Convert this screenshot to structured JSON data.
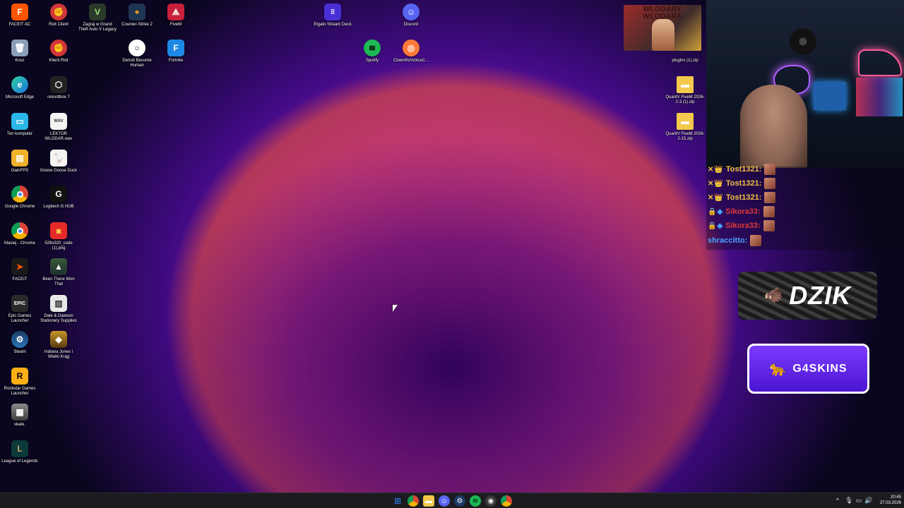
{
  "desktop_icons": {
    "faceit_ac": "FACEIT AC",
    "riot_client": "Riot Client",
    "gta": "Zagraj w Grand Theft Auto V Legacy",
    "cs2": "Counter-Strike 2",
    "fivem": "FiveM",
    "stream_deck": "Elgato Stream Deck",
    "discord": "Discord",
    "kosz": "Kosz",
    "klient_riot": "Klient Riot",
    "detroit": "Detroit Become Human",
    "fortnite": "Fortnite",
    "spotify": "Spotify",
    "clownfish": "ClownfishVoiceC...",
    "plugins": "plugins (1).zip",
    "edge": "Microsoft Edge",
    "rekordbox": "rekordbox 7",
    "quantv1": "QuantV FiveM 2026-2-3 (1).zip",
    "ten_komputer": "Ten komputer",
    "lektor": "LEKTOR WLODAR.wav",
    "quantv2": "QuantV FiveM 2026-2-15.zip",
    "gainfps": "GainFPS",
    "goose": "Goose Goose Duck",
    "chrome": "Google Chrome",
    "logitech": "Logitech G HUB",
    "maciej_chrome": "Maciej - Chrome",
    "png528": "528x320_code (1).png",
    "faceit": "FACEIT",
    "been_there": "Been There Won That",
    "epic": "Epic Games Launcher",
    "dale": "Dale & Dawson Stationery Supplies",
    "steam": "Steam",
    "indiana": "Indiana Jones i Wielki Krąg",
    "rockstar": "Rockstar Games Launcher",
    "skate": "skate.",
    "lol": "League of Legends"
  },
  "overlay": {
    "wlodara_title": "WLODARY WLODARA",
    "chat": [
      {
        "badges": "✕👑",
        "user": "Tost1321:",
        "color": "#f0c040"
      },
      {
        "badges": "✕👑",
        "user": "Tost1321:",
        "color": "#f0c040"
      },
      {
        "badges": "✕👑",
        "user": "Tost1321:",
        "color": "#f0c040"
      },
      {
        "badges": "🔒◆",
        "user": "Sikora33:",
        "color": "#e03a3a"
      },
      {
        "badges": "🔒◆",
        "user": "Sikora33:",
        "color": "#e03a3a"
      },
      {
        "badges": "",
        "user": "shraccitto:",
        "color": "#4aa3ff"
      }
    ],
    "dzik_logo": "DZIK",
    "g4skins_logo": "G4SKINS"
  },
  "taskbar": {
    "clock_time": "20:45",
    "clock_date": "27.03.2026"
  },
  "colors": {
    "chrome_red": "#db4437",
    "spotify_green": "#1db954",
    "discord_blurple": "#5865f2",
    "riot_red": "#d13639",
    "windows_blue": "#2a8cff"
  }
}
